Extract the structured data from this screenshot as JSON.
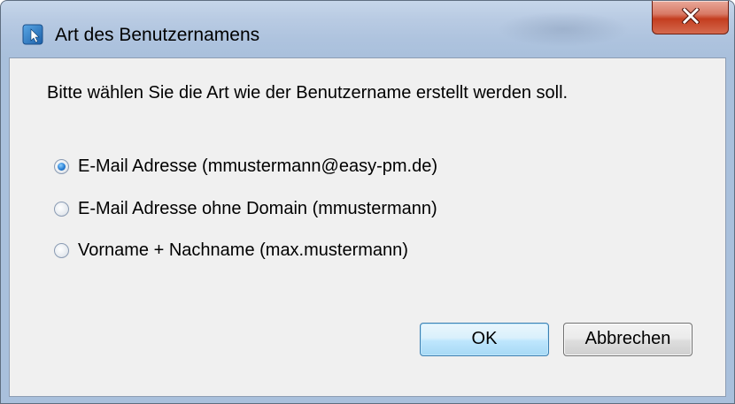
{
  "window": {
    "title": "Art des Benutzernamens",
    "close_label": "X"
  },
  "dialog": {
    "prompt": "Bitte wählen Sie die Art wie der Benutzername erstellt werden soll.",
    "options": [
      {
        "label": "E-Mail Adresse (mmustermann@easy-pm.de)",
        "checked": true
      },
      {
        "label": "E-Mail Adresse ohne Domain (mmustermann)",
        "checked": false
      },
      {
        "label": "Vorname + Nachname (max.mustermann)",
        "checked": false
      }
    ],
    "ok_label": "OK",
    "cancel_label": "Abbrechen"
  },
  "colors": {
    "title_bar": "#b9cbe3",
    "close_button": "#c43d1f",
    "client_background": "#f0f0f0",
    "ok_border": "#3c7fb1",
    "radio_selected": "#2a7fd4"
  },
  "icons": {
    "app": "user-app-icon",
    "close": "close-icon"
  }
}
